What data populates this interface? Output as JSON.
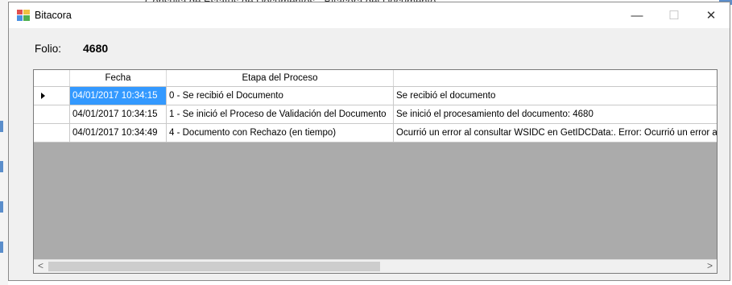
{
  "background": {
    "top_text": "Consulta de Estatus de Documentos - Bitacora del Documento"
  },
  "window": {
    "title": "Bitacora",
    "controls": {
      "minimize": "—",
      "maximize": "☐",
      "close": "✕"
    }
  },
  "folio": {
    "label": "Folio:",
    "value": "4680"
  },
  "grid": {
    "columns": [
      "",
      "Fecha",
      "Etapa del Proceso",
      ""
    ],
    "rows": [
      {
        "fecha": "04/01/2017 10:34:15",
        "etapa": "0 - Se recibió el Documento",
        "detalle": "Se recibió el documento",
        "current": true
      },
      {
        "fecha": "04/01/2017 10:34:15",
        "etapa": "1 - Se inició el Proceso de Validación del Documento",
        "detalle": "Se inició el procesamiento del documento: 4680",
        "current": false
      },
      {
        "fecha": "04/01/2017 10:34:49",
        "etapa": "4 - Documento con Rechazo (en tiempo)",
        "detalle": "Ocurrió un error al consultar WSIDC en GetIDCData:. Error: Ocurrió un error al",
        "current": false
      }
    ],
    "scroll": {
      "left": "<",
      "right": ">"
    }
  },
  "colors": {
    "selection": "#3399ff",
    "grid_empty": "#ababab",
    "window_bg": "#f0f0f0"
  }
}
